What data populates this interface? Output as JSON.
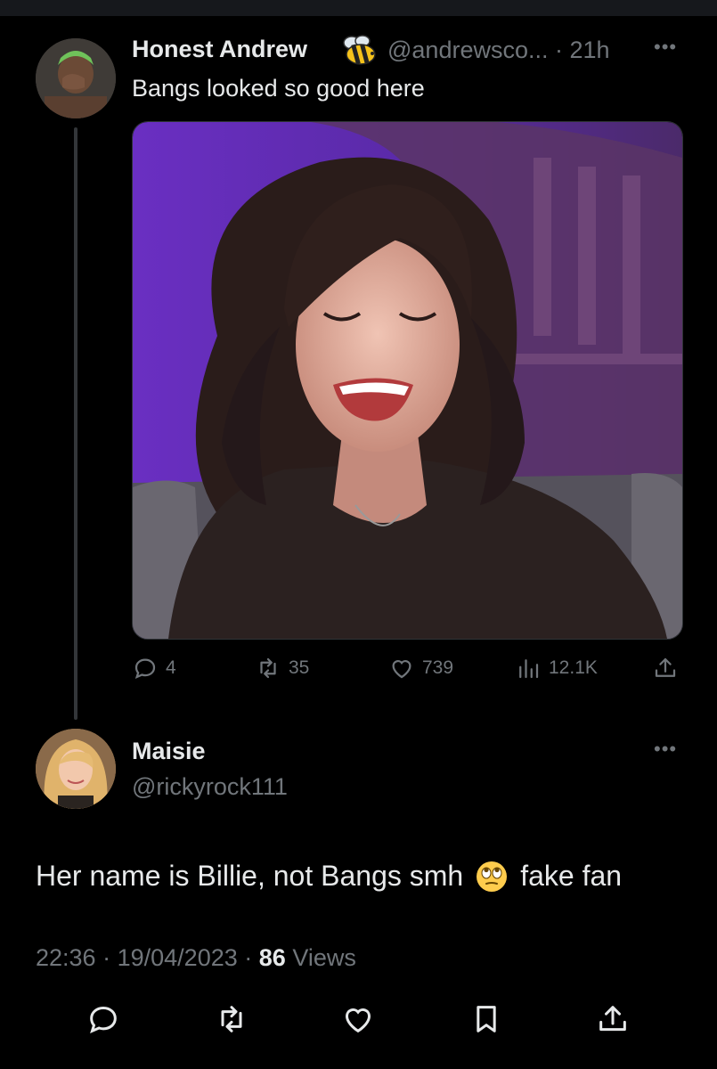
{
  "parent_tweet": {
    "author_name": "Honest Andrew",
    "author_emoji": "bee-emoji",
    "handle": "@andrewsco...",
    "separator": "·",
    "time_ago": "21h",
    "text": "Bangs looked so good here",
    "media_description": "photo",
    "stats": {
      "replies": "4",
      "retweets": "35",
      "likes": "739",
      "views": "12.1K"
    }
  },
  "reply_tweet": {
    "author_name": "Maisie",
    "handle": "@rickyrock111",
    "text_before": "Her name is Billie, not Bangs smh",
    "emoji": "face-with-rolling-eyes",
    "text_after": "fake fan",
    "time": "22:36",
    "date": "19/04/2023",
    "views_count": "86",
    "views_label": "Views",
    "sep": "·"
  },
  "icons": {
    "more": "more-icon",
    "reply": "reply-icon",
    "retweet": "retweet-icon",
    "like": "heart-icon",
    "views": "analytics-icon",
    "share": "share-icon",
    "bookmark": "bookmark-icon"
  },
  "colors": {
    "background": "#000000",
    "text": "#e7e9ea",
    "secondary": "#71767b",
    "thread_line": "#333639"
  }
}
